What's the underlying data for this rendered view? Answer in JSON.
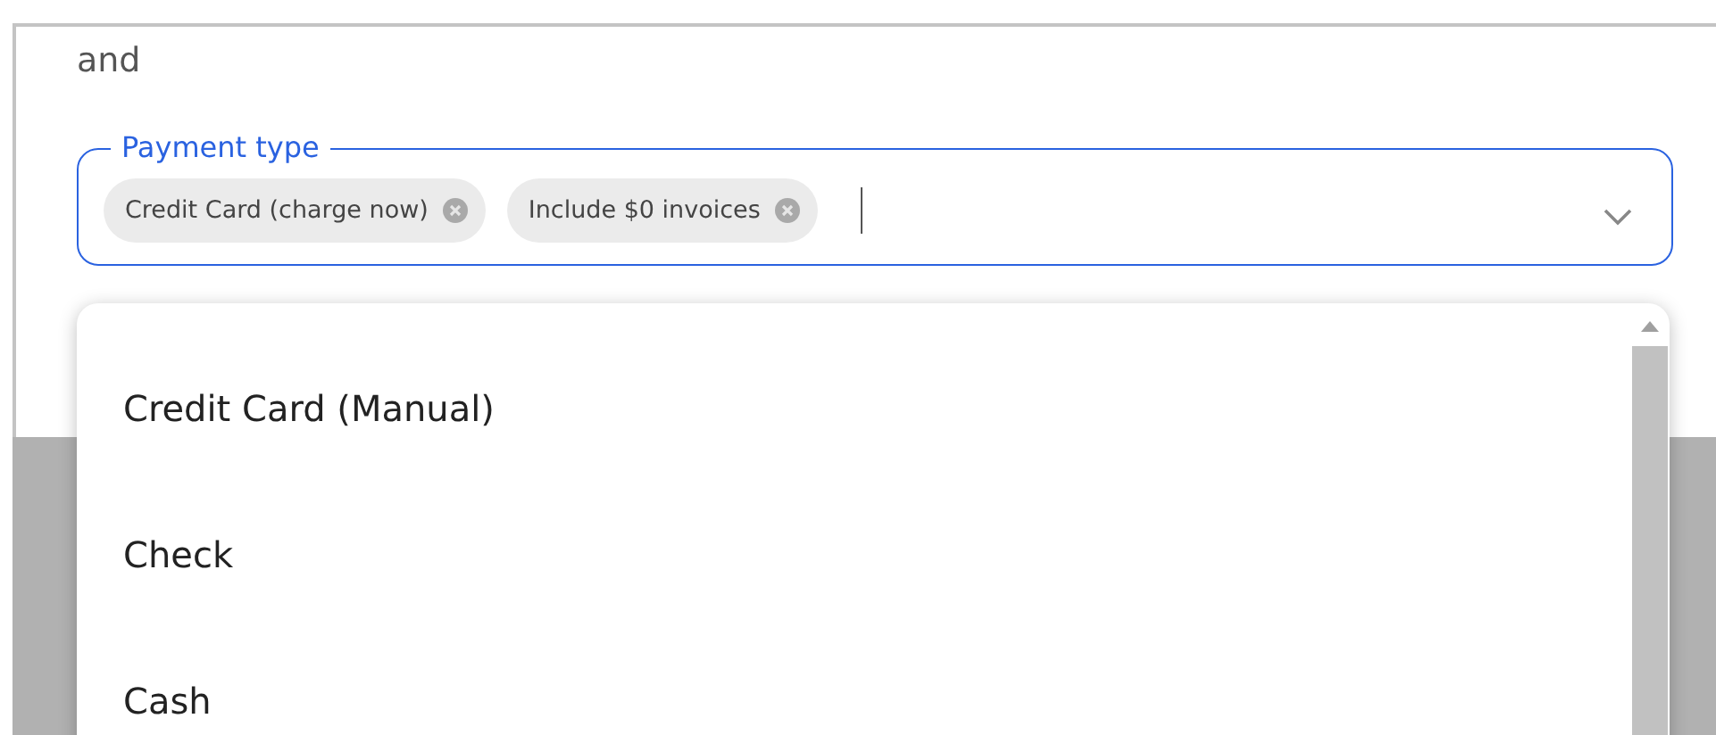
{
  "connector": "and",
  "payment_type": {
    "label": "Payment type",
    "focused": true,
    "chips": [
      {
        "label": "Credit Card (charge now)"
      },
      {
        "label": "Include $0 invoices"
      }
    ],
    "open": true
  },
  "options": [
    {
      "label": "Credit Card (Manual)"
    },
    {
      "label": "Check"
    },
    {
      "label": "Cash"
    }
  ]
}
